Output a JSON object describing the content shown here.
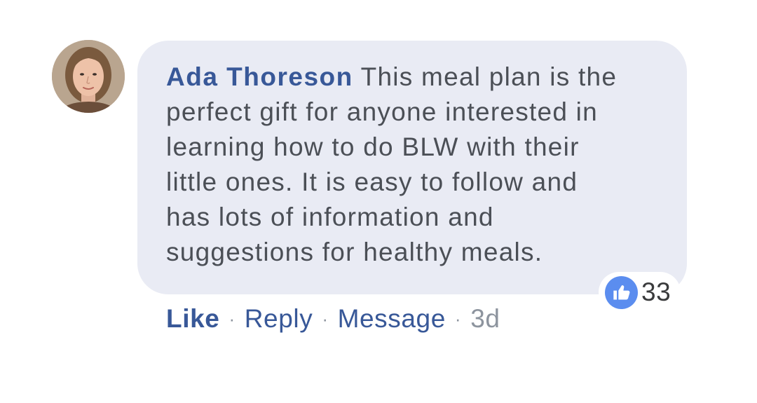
{
  "comment": {
    "author": "Ada Thoreson",
    "text": "This meal plan is the\nperfect gift for anyone interested in\nlearning how to do BLW with their\nlittle ones. It is easy to follow and\nhas lots of information and\nsuggestions for healthy meals."
  },
  "reactions": {
    "icon": "thumbs-up-icon",
    "count": "33",
    "color": "#5b8def"
  },
  "actions": {
    "like": "Like",
    "reply": "Reply",
    "message": "Message",
    "separator": "·",
    "timestamp": "3d"
  },
  "colors": {
    "bubble": "#e9ebf4",
    "author": "#385898",
    "text": "#4b4f56",
    "muted": "#8d949e"
  }
}
